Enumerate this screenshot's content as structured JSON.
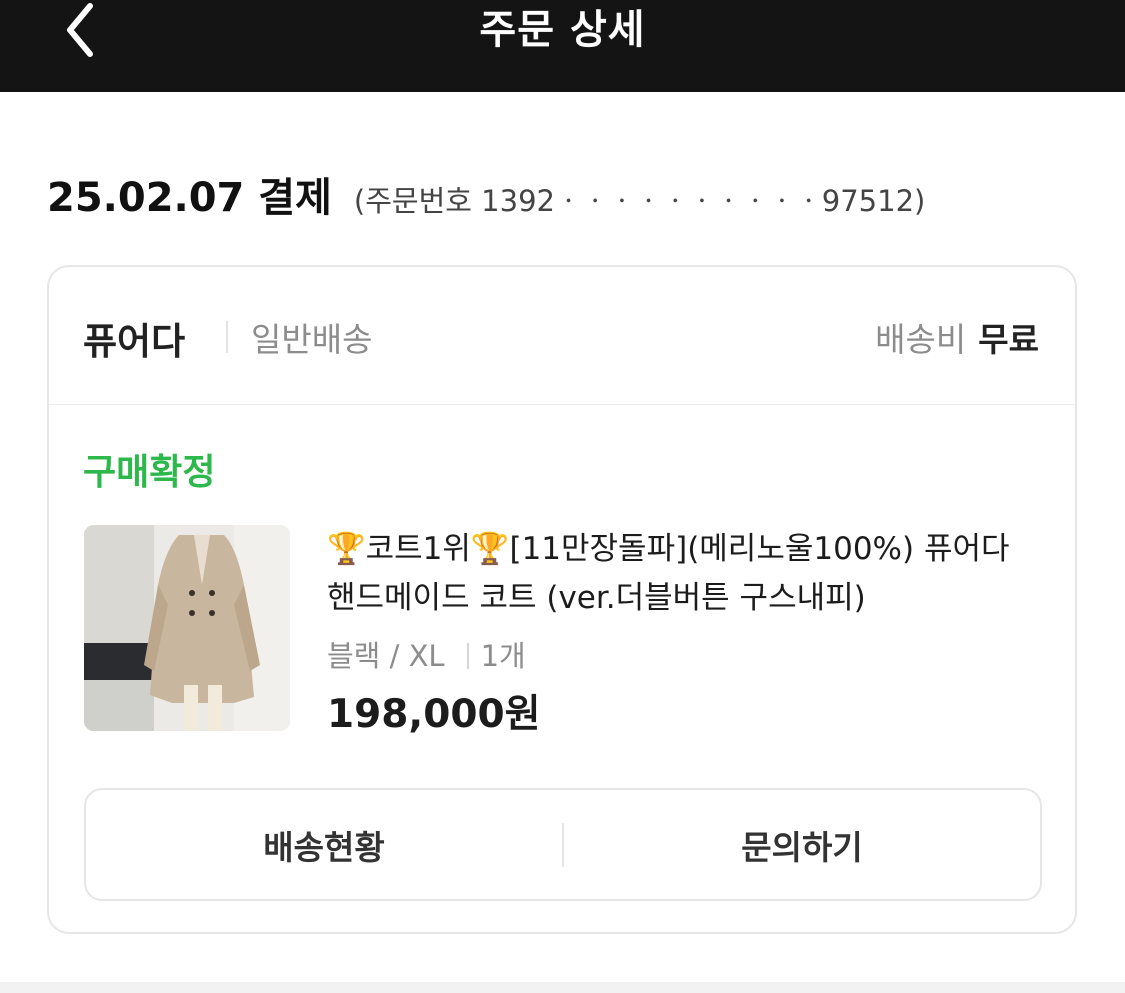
{
  "header": {
    "title": "주문 상세",
    "back_icon": "chevron-left-icon"
  },
  "order": {
    "date_label": "25.02.07 결제",
    "order_number_text": "(주문번호 1392ㆍㆍㆍㆍㆍㆍㆍㆍㆍㆍ97512)"
  },
  "card": {
    "seller": "퓨어다",
    "delivery_type": "일반배송",
    "shipping_fee_label": "배송비",
    "shipping_fee_value": "무료",
    "status": "구매확정",
    "status_color": "#2db84b",
    "product": {
      "title": "🏆코트1위🏆[11만장돌파](메리노울100%) 퓨어다 핸드메이드 코트 (ver.더블버튼 구스내피)",
      "option": "블랙 / XL",
      "quantity": "1개",
      "price": "198,000원"
    },
    "buttons": {
      "tracking": "배송현황",
      "inquiry": "문의하기"
    }
  }
}
